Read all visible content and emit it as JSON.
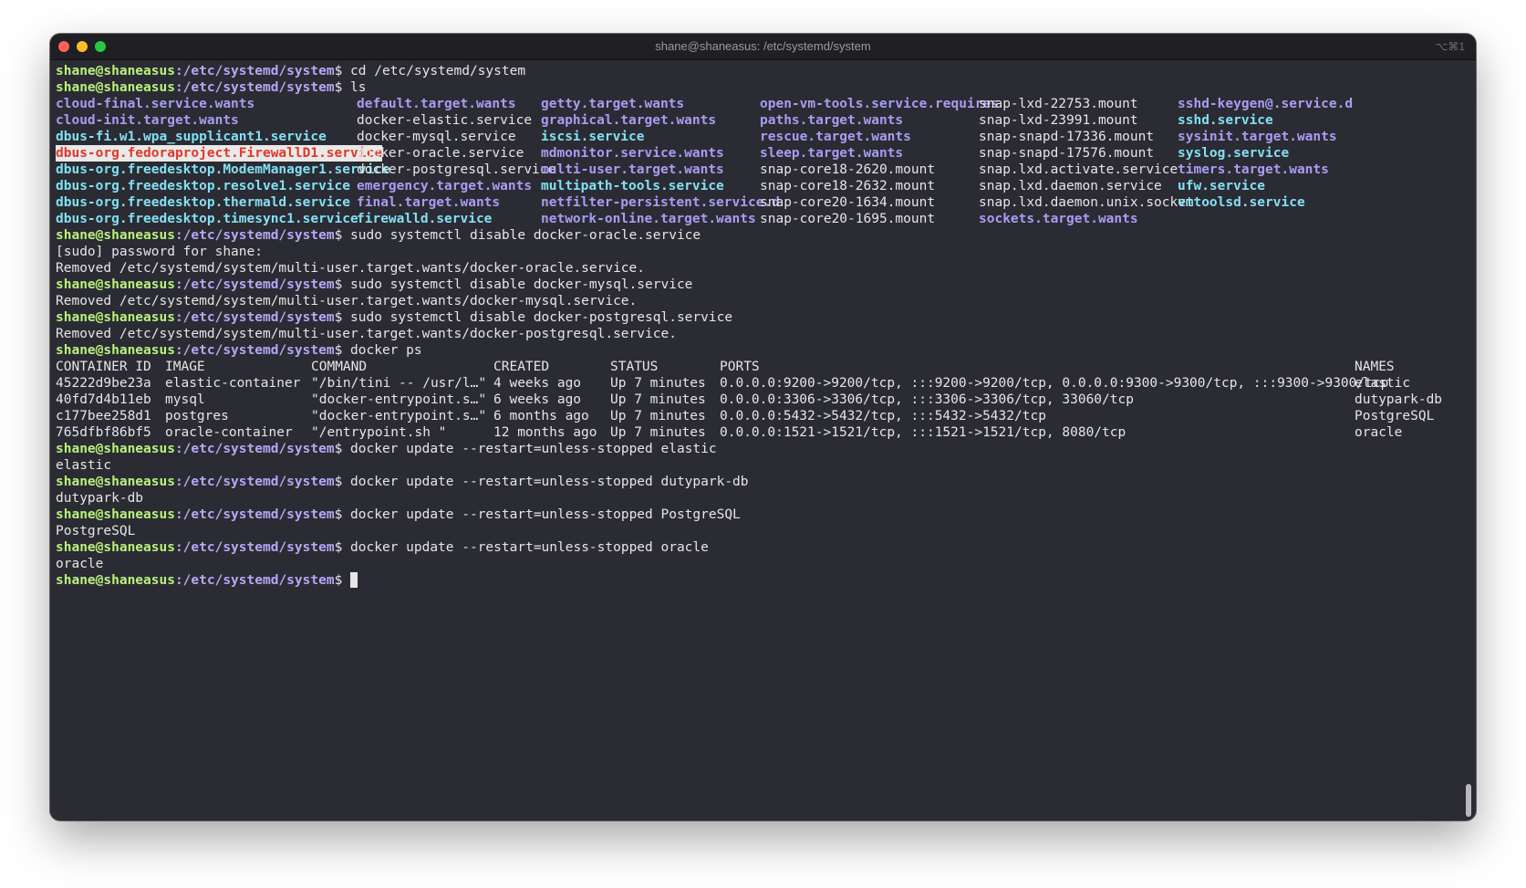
{
  "window": {
    "title": "shane@shaneasus: /etc/systemd/system",
    "shortcut": "⌥⌘1"
  },
  "prompt": {
    "user_host": "shane@shaneasus",
    "path": ":/etc/systemd/system",
    "dollar": "$ "
  },
  "commands": {
    "c1": "cd /etc/systemd/system",
    "c2": "ls",
    "c3": "sudo systemctl disable docker-oracle.service",
    "c4": "sudo systemctl disable docker-mysql.service",
    "c5": "sudo systemctl disable docker-postgresql.service",
    "c6": "docker ps",
    "c7": "docker update --restart=unless-stopped elastic",
    "c8": "docker update --restart=unless-stopped dutypark-db",
    "c9": "docker update --restart=unless-stopped PostgreSQL",
    "c10": "docker update --restart=unless-stopped oracle"
  },
  "ls_rows": [
    [
      "cloud-final.service.wants",
      "default.target.wants",
      "getty.target.wants",
      "open-vm-tools.service.requires",
      "snap-lxd-22753.mount",
      "sshd-keygen@.service.d"
    ],
    [
      "cloud-init.target.wants",
      "docker-elastic.service",
      "graphical.target.wants",
      "paths.target.wants",
      "snap-lxd-23991.mount",
      "sshd.service"
    ],
    [
      "dbus-fi.w1.wpa_supplicant1.service",
      "docker-mysql.service",
      "iscsi.service",
      "rescue.target.wants",
      "snap-snapd-17336.mount",
      "sysinit.target.wants"
    ],
    [
      "dbus-org.fedoraproject.FirewallD1.service",
      "docker-oracle.service",
      "mdmonitor.service.wants",
      "sleep.target.wants",
      "snap-snapd-17576.mount",
      "syslog.service"
    ],
    [
      "dbus-org.freedesktop.ModemManager1.service",
      "docker-postgresql.service",
      "multi-user.target.wants",
      "snap-core18-2620.mount",
      "snap.lxd.activate.service",
      "timers.target.wants"
    ],
    [
      "dbus-org.freedesktop.resolve1.service",
      "emergency.target.wants",
      "multipath-tools.service",
      "snap-core18-2632.mount",
      "snap.lxd.daemon.service",
      "ufw.service"
    ],
    [
      "dbus-org.freedesktop.thermald.service",
      "final.target.wants",
      "netfilter-persistent.service.d",
      "snap-core20-1634.mount",
      "snap.lxd.daemon.unix.socket",
      "vmtoolsd.service"
    ],
    [
      "dbus-org.freedesktop.timesync1.service",
      "firewalld.service",
      "network-online.target.wants",
      "snap-core20-1695.mount",
      "sockets.target.wants",
      ""
    ]
  ],
  "outputs": {
    "o1": "[sudo] password for shane:",
    "o2": "Removed /etc/systemd/system/multi-user.target.wants/docker-oracle.service.",
    "o3": "Removed /etc/systemd/system/multi-user.target.wants/docker-mysql.service.",
    "o4": "Removed /etc/systemd/system/multi-user.target.wants/docker-postgresql.service.",
    "o5": "elastic",
    "o6": "dutypark-db",
    "o7": "PostgreSQL",
    "o8": "oracle"
  },
  "docker_ps": {
    "headers": [
      "CONTAINER ID",
      "IMAGE",
      "COMMAND",
      "CREATED",
      "STATUS",
      "PORTS",
      "NAMES"
    ],
    "rows": [
      [
        "45222d9be23a",
        "elastic-container",
        "\"/bin/tini -- /usr/l…\"",
        "4 weeks ago",
        "Up 7 minutes",
        "0.0.0.0:9200->9200/tcp, :::9200->9200/tcp, 0.0.0.0:9300->9300/tcp, :::9300->9300/tcp",
        "elastic"
      ],
      [
        "40fd7d4b11eb",
        "mysql",
        "\"docker-entrypoint.s…\"",
        "6 weeks ago",
        "Up 7 minutes",
        "0.0.0.0:3306->3306/tcp, :::3306->3306/tcp, 33060/tcp",
        "dutypark-db"
      ],
      [
        "c177bee258d1",
        "postgres",
        "\"docker-entrypoint.s…\"",
        "6 months ago",
        "Up 7 minutes",
        "0.0.0.0:5432->5432/tcp, :::5432->5432/tcp",
        "PostgreSQL"
      ],
      [
        "765dfbf86bf5",
        "oracle-container",
        "\"/entrypoint.sh \"",
        "12 months ago",
        "Up 7 minutes",
        "0.0.0.0:1521->1521/tcp, :::1521->1521/tcp, 8080/tcp",
        "oracle"
      ]
    ]
  },
  "colors": {
    "background": "#2b2b33",
    "prompt_user": "#b9f27c",
    "prompt_path": "#b5a8f5",
    "directory": "#a99cf2",
    "service": "#82e0f2",
    "highlight_bg": "#e9e9e9",
    "highlight_fg": "#e0382a"
  }
}
